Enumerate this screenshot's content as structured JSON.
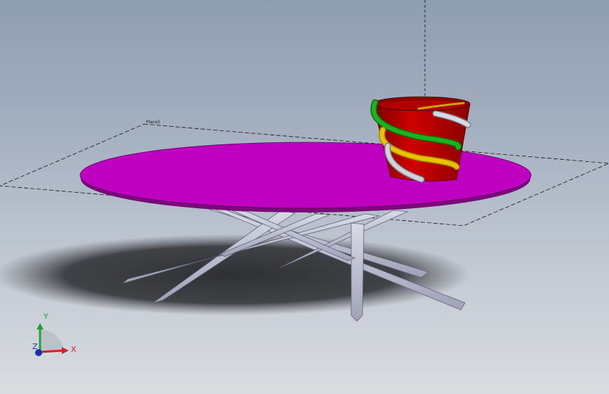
{
  "viewport": {
    "plane_label": "Plane5"
  },
  "triad": {
    "x_label": "X",
    "y_label": "Y",
    "z_label": "Z",
    "x_color": "#d0202a",
    "y_color": "#1aa337",
    "z_color": "#1b2fb0"
  },
  "model": {
    "tabletop_color": "#c000c0",
    "legs_color": "#c3c6d8",
    "vase_color": "#cc0000",
    "coil_colors": [
      "#16a31a",
      "#e0c000",
      "#c8c8d8"
    ]
  }
}
